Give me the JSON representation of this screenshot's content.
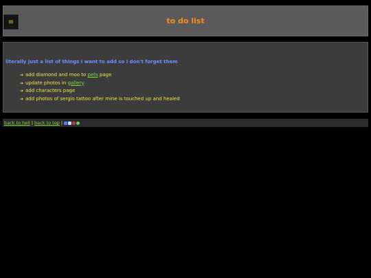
{
  "header": {
    "title": "to do list",
    "menu_icon": "menu-icon",
    "menu_glyph": "≡"
  },
  "content": {
    "intro": "literally just a list of things i want to add so i don't forget them",
    "items": [
      {
        "before": "add diamond and moo to ",
        "link": "pets",
        "after": " page"
      },
      {
        "before": "update photos in ",
        "link": "gallery",
        "after": ""
      },
      {
        "before": "add characters page",
        "link": "",
        "after": ""
      },
      {
        "before": "add photos of sergio tattoo after mine is touched up and healed",
        "link": "",
        "after": ""
      }
    ],
    "bullet_glyph": "➔"
  },
  "footer": {
    "back_to_hell": "back to hell",
    "back_to_top": "back to top",
    "separator": "|"
  },
  "colors": {
    "title": "#ff8a1a",
    "intro": "#6f8fff",
    "text": "#f0e54a",
    "link": "#7ddc3c"
  }
}
